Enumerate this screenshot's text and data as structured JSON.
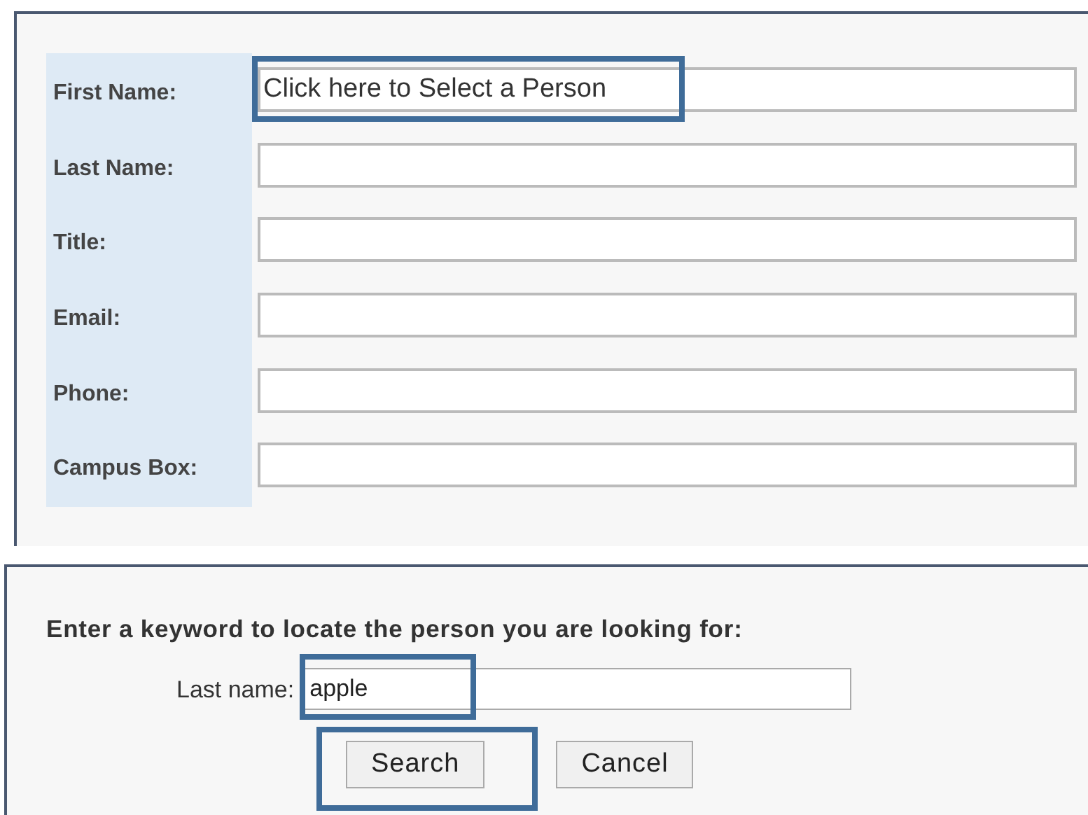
{
  "person_form": {
    "fields": [
      {
        "label": "First Name:",
        "value": "Click here to Select a Person",
        "highlighted": true
      },
      {
        "label": "Last Name:",
        "highlighted": false
      },
      {
        "label": "Title:",
        "highlighted": false
      },
      {
        "label": "Email:",
        "highlighted": false
      },
      {
        "label": "Phone:",
        "highlighted": false
      },
      {
        "label": "Campus Box:",
        "highlighted": false
      }
    ]
  },
  "search_dialog": {
    "prompt": "Enter a keyword to locate the person you are looking for:",
    "field": {
      "label": "Last name:",
      "value": "apple",
      "highlighted": true
    },
    "buttons": [
      {
        "label": "Search",
        "highlighted": true
      },
      {
        "label": "Cancel",
        "highlighted": false
      }
    ]
  }
}
